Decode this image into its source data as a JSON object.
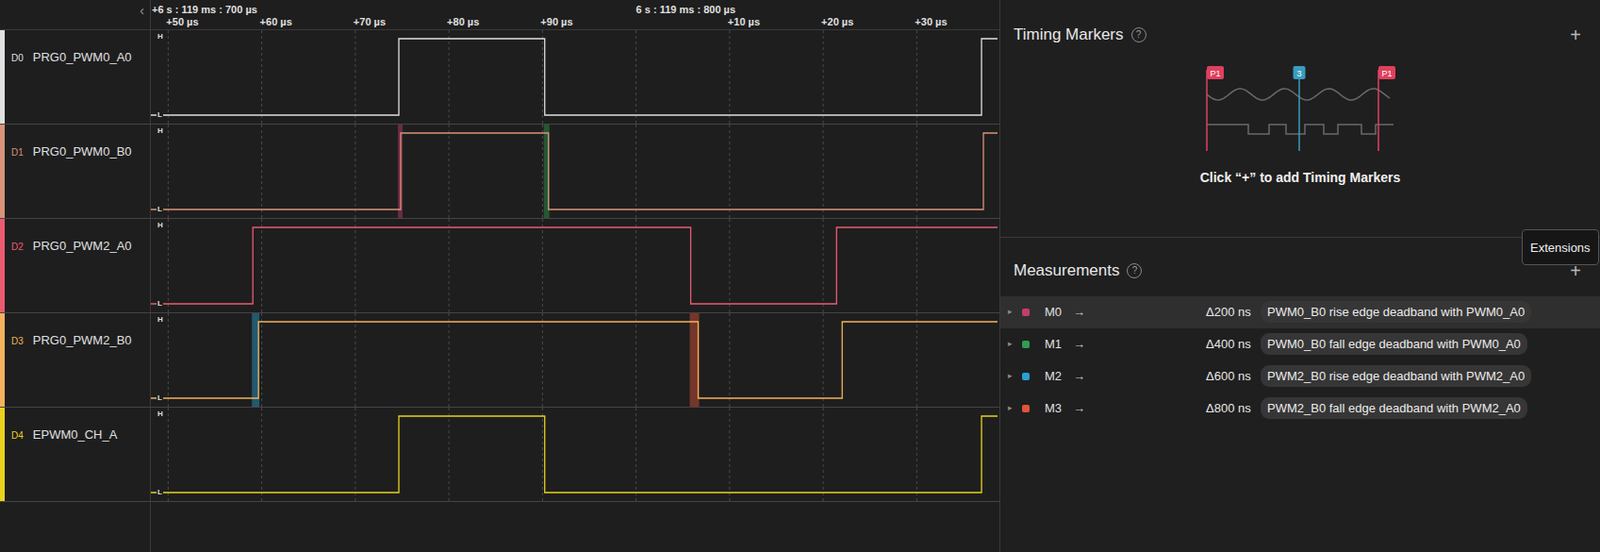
{
  "ruler": {
    "collapse": "‹",
    "majors": [
      {
        "label": "+6 s : 119 ms : 700 µs",
        "t": 48.25
      },
      {
        "label": "6 s : 119 ms : 800 µs",
        "t": 100
      }
    ],
    "ticks": [
      {
        "label": "+50 µs",
        "t": 50
      },
      {
        "label": "+60 µs",
        "t": 60
      },
      {
        "label": "+70 µs",
        "t": 70
      },
      {
        "label": "+80 µs",
        "t": 80
      },
      {
        "label": "+90 µs",
        "t": 90
      },
      {
        "label": "+10 µs",
        "t": 110
      },
      {
        "label": "+20 µs",
        "t": 120
      },
      {
        "label": "+30 µs",
        "t": 130
      }
    ],
    "grid": [
      50,
      60,
      70,
      80,
      90,
      100,
      110,
      120,
      130
    ]
  },
  "channels": [
    {
      "id": "D0",
      "name": "PRG0_PWM0_A0",
      "color": "#e0e0e0",
      "high": "H",
      "low": "L",
      "initial_level": 0,
      "edges": [
        74.65,
        90.24,
        136.92
      ]
    },
    {
      "id": "D1",
      "name": "PRG0_PWM0_B0",
      "color": "#d9937a",
      "high": "H",
      "low": "L",
      "initial_level": 0,
      "edges": [
        74.85,
        90.64,
        137.12
      ]
    },
    {
      "id": "D2",
      "name": "PRG0_PWM2_A0",
      "color": "#ec5b72",
      "high": "H",
      "low": "L",
      "initial_level": 0,
      "edges": [
        59.05,
        105.84,
        121.43
      ]
    },
    {
      "id": "D3",
      "name": "PRG0_PWM2_B0",
      "color": "#f3b35c",
      "high": "H",
      "low": "L",
      "initial_level": 0,
      "edges": [
        59.65,
        106.64,
        122.03
      ]
    },
    {
      "id": "D4",
      "name": "EPWM0_CH_A",
      "color": "#e8d21e",
      "high": "H",
      "low": "L",
      "initial_level": 0,
      "edges": [
        74.65,
        90.24,
        136.92
      ]
    }
  ],
  "timing_markers": {
    "title": "Timing Markers",
    "help": "?",
    "add": "+",
    "illustration": [
      {
        "label": "P1",
        "color": "#e0405e"
      },
      {
        "label": "3",
        "color": "#3a9bc0"
      },
      {
        "label": "P1",
        "color": "#e0405e"
      }
    ],
    "hint": "Click “+” to add Timing Markers"
  },
  "tooltip": {
    "text": "Extensions"
  },
  "measurements": {
    "title": "Measurements",
    "help": "?",
    "add": "+",
    "items": [
      {
        "caret": "▸",
        "label": "M0",
        "arrow": "→",
        "value": "Δ200 ns",
        "note": "PWM0_B0 rise edge deadband with PWM0_A0",
        "color": "#c43d6a",
        "selected": true,
        "channel": 1,
        "start": 74.65,
        "end": 74.85
      },
      {
        "caret": "▸",
        "label": "M1",
        "arrow": "→",
        "value": "Δ400 ns",
        "note": "PWM0_B0 fall edge deadband with PWM0_A0",
        "color": "#2e9e50",
        "selected": false,
        "channel": 1,
        "start": 90.24,
        "end": 90.64
      },
      {
        "caret": "▸",
        "label": "M2",
        "arrow": "→",
        "value": "Δ600 ns",
        "note": "PWM2_B0 rise edge deadband with PWM2_A0",
        "color": "#2a9fd6",
        "selected": false,
        "channel": 3,
        "start": 59.05,
        "end": 59.65
      },
      {
        "caret": "▸",
        "label": "M3",
        "arrow": "→",
        "value": "Δ800 ns",
        "note": "PWM2_B0 fall edge deadband with PWM2_A0",
        "color": "#e0553a",
        "selected": false,
        "channel": 3,
        "start": 105.84,
        "end": 106.64
      }
    ]
  }
}
